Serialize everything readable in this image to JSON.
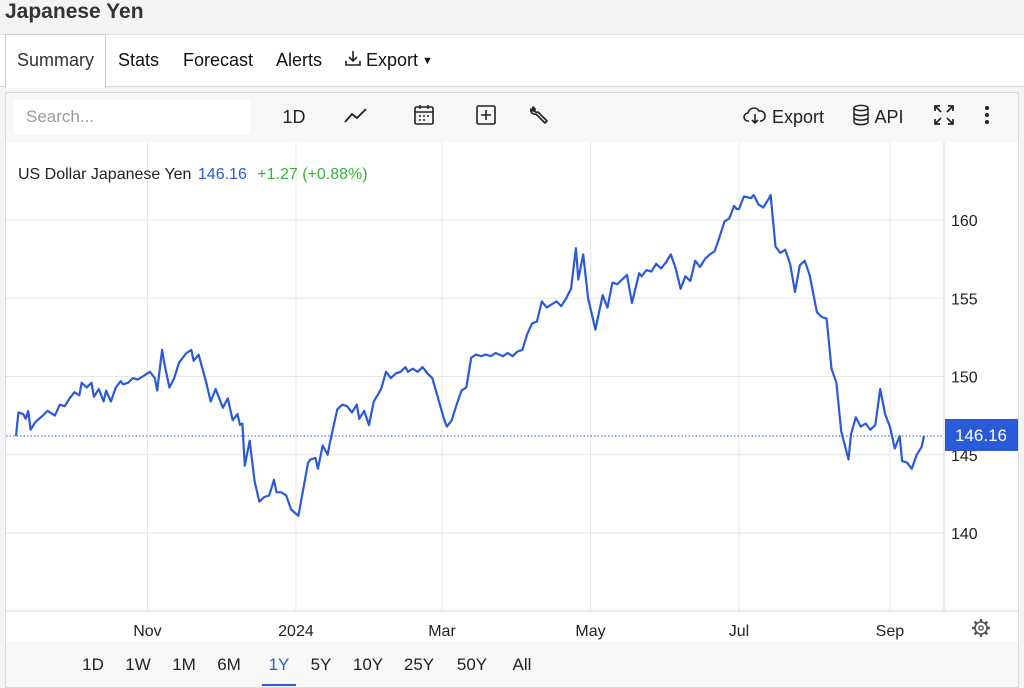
{
  "page_title": "Japanese Yen",
  "tabs": [
    {
      "label": "Summary"
    },
    {
      "label": "Stats"
    },
    {
      "label": "Forecast"
    },
    {
      "label": "Alerts"
    },
    {
      "label": "Export"
    }
  ],
  "toolbar": {
    "search_placeholder": "Search...",
    "interval_label": "1D",
    "export_label": "Export",
    "api_label": "API"
  },
  "legend": {
    "name": "US Dollar Japanese Yen",
    "price": "146.16",
    "change": "+1.27 (+0.88%)"
  },
  "range_buttons": [
    "1D",
    "1W",
    "1M",
    "6M",
    "1Y",
    "5Y",
    "10Y",
    "25Y",
    "50Y",
    "All"
  ],
  "active_range": "1Y",
  "colors": {
    "line": "#2a5ad8",
    "change_up": "#36b23a",
    "grid": "#e6e6e6"
  },
  "chart_data": {
    "type": "line",
    "title": "US Dollar Japanese Yen",
    "x_tick_labels": [
      "Nov",
      "2024",
      "Mar",
      "May",
      "Jul",
      "Sep"
    ],
    "y_ticks": [
      140,
      145,
      150,
      155,
      160
    ],
    "ylim": [
      135,
      165
    ],
    "last_price_label": "146.16",
    "grid": true,
    "series": [
      {
        "name": "US Dollar Japanese Yen",
        "points": [
          [
            "2023-09-08",
            146.2
          ],
          [
            "2023-09-09",
            147.7
          ],
          [
            "2023-09-11",
            147.6
          ],
          [
            "2023-09-12",
            147.3
          ],
          [
            "2023-09-13",
            147.8
          ],
          [
            "2023-09-14",
            146.6
          ],
          [
            "2023-09-16",
            147.1
          ],
          [
            "2023-09-19",
            147.5
          ],
          [
            "2023-09-21",
            147.8
          ],
          [
            "2023-09-24",
            147.5
          ],
          [
            "2023-09-26",
            148.2
          ],
          [
            "2023-09-28",
            148.1
          ],
          [
            "2023-09-30",
            148.6
          ],
          [
            "2023-10-02",
            149.0
          ],
          [
            "2023-10-04",
            148.8
          ],
          [
            "2023-10-05",
            149.6
          ],
          [
            "2023-10-07",
            149.3
          ],
          [
            "2023-10-09",
            149.6
          ],
          [
            "2023-10-10",
            148.7
          ],
          [
            "2023-10-12",
            149.2
          ],
          [
            "2023-10-14",
            148.4
          ],
          [
            "2023-10-15",
            149.1
          ],
          [
            "2023-10-17",
            148.4
          ],
          [
            "2023-10-19",
            149.3
          ],
          [
            "2023-10-21",
            149.7
          ],
          [
            "2023-10-22",
            149.5
          ],
          [
            "2023-10-24",
            149.6
          ],
          [
            "2023-10-26",
            149.9
          ],
          [
            "2023-10-28",
            149.8
          ],
          [
            "2023-10-30",
            150.0
          ],
          [
            "2023-11-02",
            150.3
          ],
          [
            "2023-11-04",
            149.9
          ],
          [
            "2023-11-05",
            149.1
          ],
          [
            "2023-11-07",
            151.7
          ],
          [
            "2023-11-08",
            150.8
          ],
          [
            "2023-11-10",
            149.3
          ],
          [
            "2023-11-12",
            149.9
          ],
          [
            "2023-11-14",
            150.9
          ],
          [
            "2023-11-17",
            151.5
          ],
          [
            "2023-11-19",
            151.7
          ],
          [
            "2023-11-20",
            151.0
          ],
          [
            "2023-11-22",
            151.4
          ],
          [
            "2023-11-25",
            149.7
          ],
          [
            "2023-11-27",
            148.4
          ],
          [
            "2023-11-29",
            149.2
          ],
          [
            "2023-12-02",
            148.0
          ],
          [
            "2023-12-04",
            148.6
          ],
          [
            "2023-12-06",
            147.2
          ],
          [
            "2023-12-08",
            147.6
          ],
          [
            "2023-12-09",
            146.9
          ],
          [
            "2023-12-10",
            147.0
          ],
          [
            "2023-12-11",
            144.3
          ],
          [
            "2023-12-13",
            145.9
          ],
          [
            "2023-12-15",
            143.3
          ],
          [
            "2023-12-17",
            142.0
          ],
          [
            "2023-12-19",
            142.3
          ],
          [
            "2023-12-21",
            142.4
          ],
          [
            "2023-12-23",
            143.4
          ],
          [
            "2023-12-24",
            142.6
          ],
          [
            "2023-12-26",
            142.6
          ],
          [
            "2023-12-28",
            142.4
          ],
          [
            "2023-12-30",
            141.5
          ],
          [
            "2024-01-02",
            141.1
          ],
          [
            "2024-01-06",
            144.5
          ],
          [
            "2024-01-07",
            144.7
          ],
          [
            "2024-01-09",
            144.8
          ],
          [
            "2024-01-10",
            144.1
          ],
          [
            "2024-01-12",
            145.6
          ],
          [
            "2024-01-14",
            145.0
          ],
          [
            "2024-01-15",
            145.8
          ],
          [
            "2024-01-18",
            147.9
          ],
          [
            "2024-01-20",
            148.2
          ],
          [
            "2024-01-22",
            148.1
          ],
          [
            "2024-01-24",
            147.7
          ],
          [
            "2024-01-26",
            148.2
          ],
          [
            "2024-01-27",
            147.3
          ],
          [
            "2024-01-29",
            147.8
          ],
          [
            "2024-01-31",
            146.9
          ],
          [
            "2024-02-02",
            148.4
          ],
          [
            "2024-02-05",
            149.2
          ],
          [
            "2024-02-07",
            150.3
          ],
          [
            "2024-02-09",
            149.9
          ],
          [
            "2024-02-11",
            150.2
          ],
          [
            "2024-02-13",
            150.3
          ],
          [
            "2024-02-15",
            150.6
          ],
          [
            "2024-02-16",
            150.3
          ],
          [
            "2024-02-18",
            150.5
          ],
          [
            "2024-02-20",
            150.3
          ],
          [
            "2024-02-22",
            150.6
          ],
          [
            "2024-02-24",
            150.2
          ],
          [
            "2024-02-26",
            149.9
          ],
          [
            "2024-03-02",
            147.2
          ],
          [
            "2024-03-03",
            146.8
          ],
          [
            "2024-03-05",
            147.2
          ],
          [
            "2024-03-07",
            148.2
          ],
          [
            "2024-03-09",
            149.1
          ],
          [
            "2024-03-11",
            149.3
          ],
          [
            "2024-03-13",
            151.2
          ],
          [
            "2024-03-15",
            151.4
          ],
          [
            "2024-03-17",
            151.3
          ],
          [
            "2024-03-19",
            151.4
          ],
          [
            "2024-03-21",
            151.3
          ],
          [
            "2024-03-23",
            151.5
          ],
          [
            "2024-03-26",
            151.3
          ],
          [
            "2024-03-28",
            151.5
          ],
          [
            "2024-03-30",
            151.3
          ],
          [
            "2024-04-01",
            151.6
          ],
          [
            "2024-04-03",
            151.7
          ],
          [
            "2024-04-05",
            152.7
          ],
          [
            "2024-04-07",
            153.4
          ],
          [
            "2024-04-09",
            153.5
          ],
          [
            "2024-04-11",
            154.8
          ],
          [
            "2024-04-13",
            154.4
          ],
          [
            "2024-04-15",
            154.6
          ],
          [
            "2024-04-17",
            154.8
          ],
          [
            "2024-04-19",
            154.5
          ],
          [
            "2024-04-21",
            155.0
          ],
          [
            "2024-04-23",
            155.6
          ],
          [
            "2024-04-25",
            158.2
          ],
          [
            "2024-04-26",
            156.2
          ],
          [
            "2024-04-28",
            157.8
          ],
          [
            "2024-04-30",
            155.0
          ],
          [
            "2024-05-03",
            153.0
          ],
          [
            "2024-05-06",
            155.2
          ],
          [
            "2024-05-08",
            154.4
          ],
          [
            "2024-05-10",
            156.0
          ],
          [
            "2024-05-12",
            155.9
          ],
          [
            "2024-05-14",
            156.2
          ],
          [
            "2024-05-16",
            156.5
          ],
          [
            "2024-05-18",
            154.7
          ],
          [
            "2024-05-21",
            156.6
          ],
          [
            "2024-05-22",
            156.4
          ],
          [
            "2024-05-24",
            156.8
          ],
          [
            "2024-05-26",
            156.7
          ],
          [
            "2024-05-28",
            157.2
          ],
          [
            "2024-05-30",
            156.9
          ],
          [
            "2024-06-01",
            157.3
          ],
          [
            "2024-06-03",
            157.8
          ],
          [
            "2024-06-05",
            156.9
          ],
          [
            "2024-06-07",
            155.6
          ],
          [
            "2024-06-09",
            156.4
          ],
          [
            "2024-06-11",
            156.1
          ],
          [
            "2024-06-13",
            157.4
          ],
          [
            "2024-06-15",
            157.0
          ],
          [
            "2024-06-17",
            157.5
          ],
          [
            "2024-06-19",
            157.8
          ],
          [
            "2024-06-21",
            158.0
          ],
          [
            "2024-06-23",
            158.9
          ],
          [
            "2024-06-25",
            159.9
          ],
          [
            "2024-06-27",
            160.1
          ],
          [
            "2024-06-29",
            160.9
          ],
          [
            "2024-06-30",
            160.7
          ],
          [
            "2024-07-01",
            160.7
          ],
          [
            "2024-07-03",
            161.5
          ],
          [
            "2024-07-06",
            161.4
          ],
          [
            "2024-07-07",
            161.6
          ],
          [
            "2024-07-09",
            161.0
          ],
          [
            "2024-07-11",
            160.8
          ],
          [
            "2024-07-13",
            161.3
          ],
          [
            "2024-07-14",
            161.6
          ],
          [
            "2024-07-16",
            158.3
          ],
          [
            "2024-07-18",
            157.9
          ],
          [
            "2024-07-20",
            158.1
          ],
          [
            "2024-07-22",
            157.2
          ],
          [
            "2024-07-24",
            155.4
          ],
          [
            "2024-07-26",
            157.1
          ],
          [
            "2024-07-28",
            157.4
          ],
          [
            "2024-07-30",
            156.5
          ],
          [
            "2024-08-02",
            154.1
          ],
          [
            "2024-08-04",
            153.8
          ],
          [
            "2024-08-06",
            153.7
          ],
          [
            "2024-08-08",
            150.5
          ],
          [
            "2024-08-10",
            149.6
          ],
          [
            "2024-08-12",
            146.5
          ],
          [
            "2024-08-15",
            144.7
          ],
          [
            "2024-08-16",
            146.3
          ],
          [
            "2024-08-18",
            147.4
          ],
          [
            "2024-08-20",
            146.8
          ],
          [
            "2024-08-22",
            147.0
          ],
          [
            "2024-08-24",
            146.6
          ],
          [
            "2024-08-26",
            146.9
          ],
          [
            "2024-08-28",
            149.2
          ],
          [
            "2024-08-30",
            147.6
          ],
          [
            "2024-09-01",
            146.8
          ],
          [
            "2024-09-03",
            145.4
          ],
          [
            "2024-09-05",
            146.2
          ],
          [
            "2024-09-06",
            144.6
          ],
          [
            "2024-09-08",
            144.5
          ],
          [
            "2024-09-10",
            144.1
          ],
          [
            "2024-09-12",
            145.0
          ],
          [
            "2024-09-14",
            145.5
          ],
          [
            "2024-09-15",
            146.2
          ]
        ]
      }
    ]
  }
}
